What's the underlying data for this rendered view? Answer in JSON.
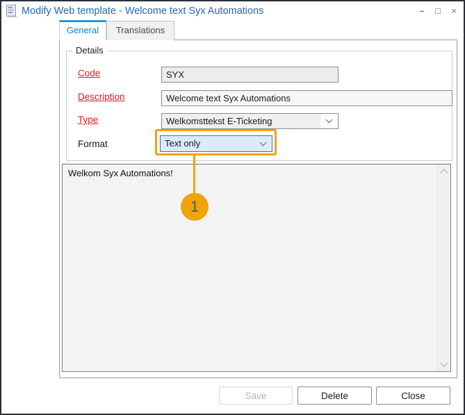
{
  "window": {
    "title": "Modify Web template - Welcome text Syx Automations",
    "controls": {
      "minimize": "–",
      "maximize": "□",
      "close": "×"
    }
  },
  "tabs": {
    "general": "General",
    "translations": "Translations"
  },
  "details": {
    "group_label": "Details",
    "code": {
      "label": "Code",
      "value": "SYX",
      "required": true
    },
    "description": {
      "label": "Description",
      "value": "Welcome text Syx Automations",
      "required": true
    },
    "type": {
      "label": "Type",
      "value": "Welkomsttekst E-Ticketing",
      "required": true
    },
    "format": {
      "label": "Format",
      "value": "Text only",
      "required": false
    }
  },
  "editor": {
    "text": "Welkom Syx Automations!"
  },
  "callout": {
    "number": "1"
  },
  "buttons": {
    "save": {
      "label": "Save",
      "enabled": false
    },
    "delete": {
      "label": "Delete",
      "enabled": true
    },
    "close": {
      "label": "Close",
      "enabled": true
    }
  },
  "icons": {
    "app": "template-document-icon",
    "chevron_down": "chevron-down",
    "scroll_up": "chevron-up",
    "scroll_down": "chevron-down"
  },
  "colors": {
    "accent_orange": "#F0A30A",
    "required_red": "#E21B23",
    "active_tab_bar": "#1B9DE2",
    "active_tab_text": "#127DD2",
    "title_text": "#2467B5",
    "format_focus_border": "#3973B8",
    "dialog_border": "#2A3038"
  }
}
